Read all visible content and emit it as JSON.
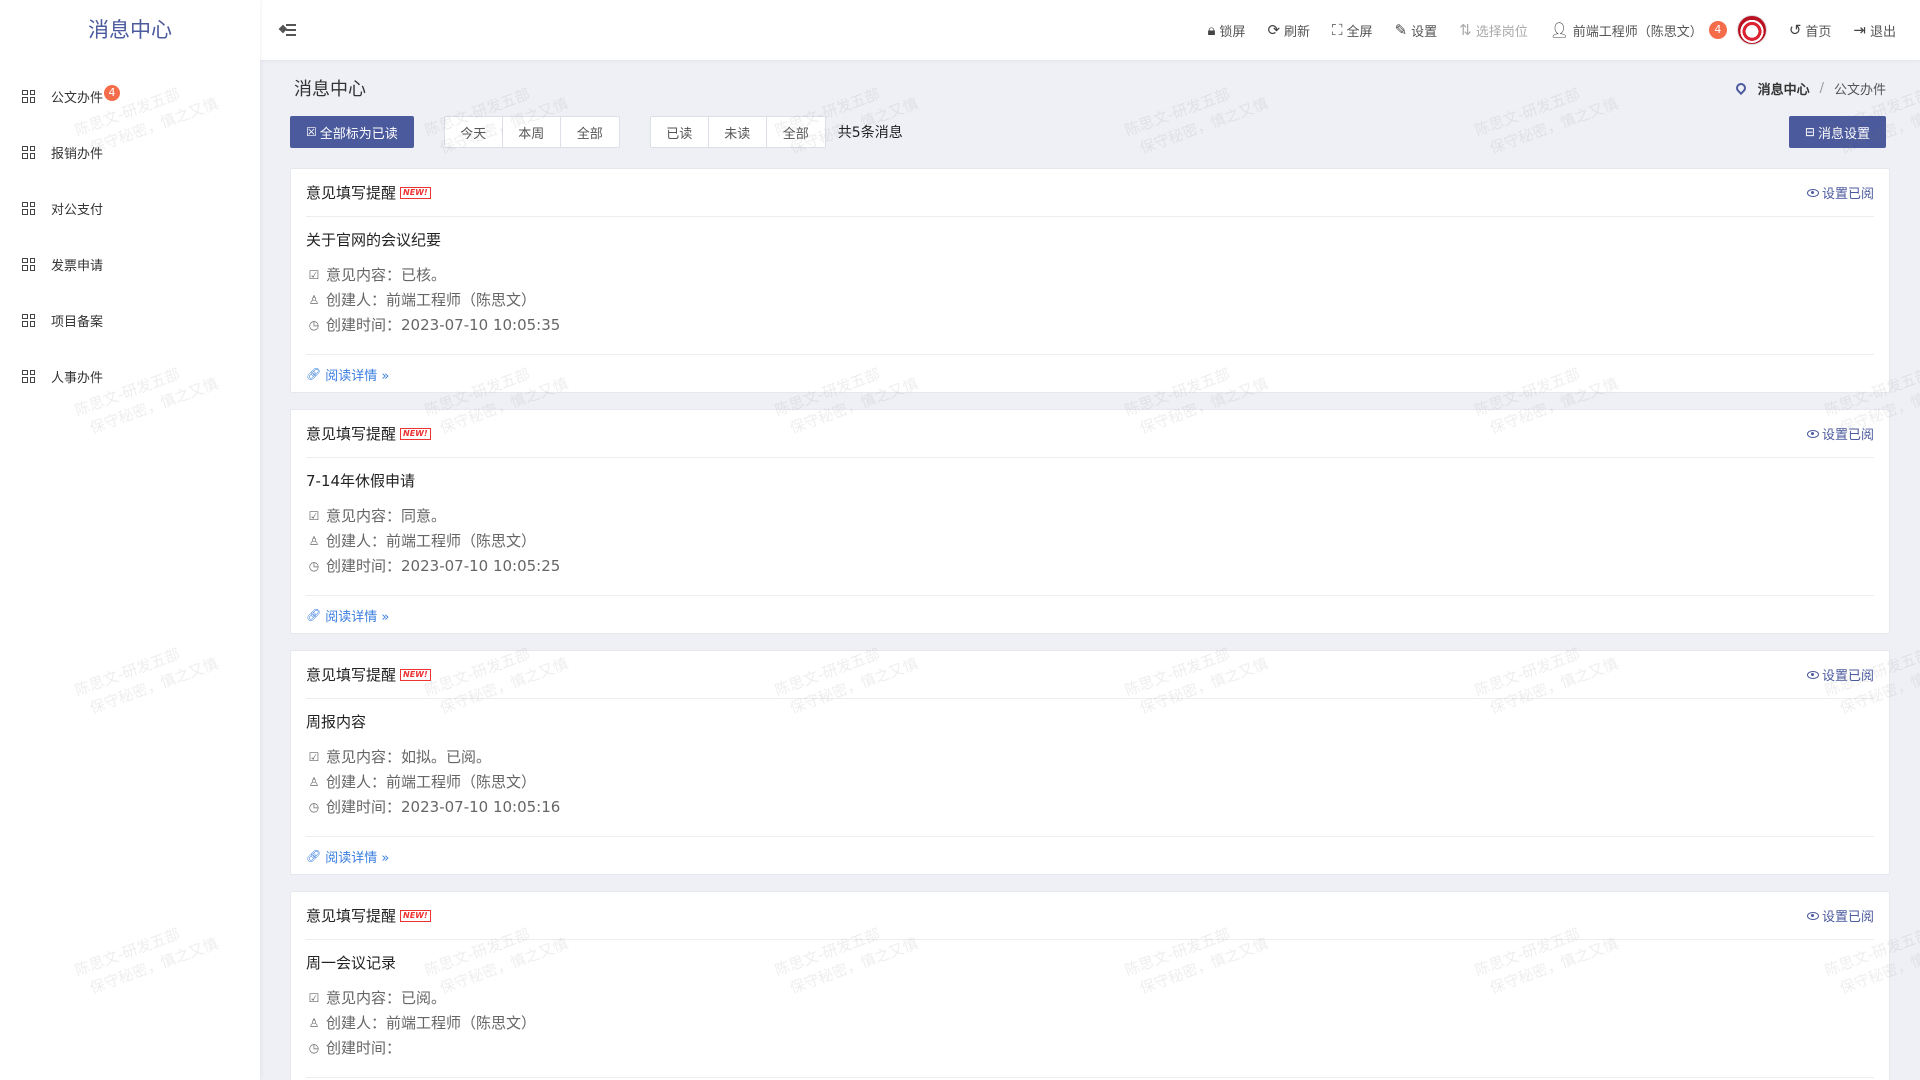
{
  "app": {
    "logo_title": "消息中心"
  },
  "sidebar": {
    "items": [
      {
        "label": "公文办件",
        "badge": "4"
      },
      {
        "label": "报销办件"
      },
      {
        "label": "对公支付"
      },
      {
        "label": "发票申请"
      },
      {
        "label": "项目备案"
      },
      {
        "label": "人事办件"
      }
    ]
  },
  "header": {
    "tools": [
      {
        "label": "锁屏",
        "icon": "lock-icon",
        "glyph": "🔒︎"
      },
      {
        "label": "刷新",
        "icon": "refresh-icon",
        "glyph": "⟳"
      },
      {
        "label": "全屏",
        "icon": "fullscreen-icon",
        "glyph": "⛶"
      },
      {
        "label": "设置",
        "icon": "edit-settings-icon",
        "glyph": "✎"
      },
      {
        "label": "选择岗位",
        "icon": "switch-position-icon",
        "glyph": "⇅",
        "disabled": true
      },
      {
        "label": "前端工程师（陈思文）",
        "icon": "user-icon",
        "glyph": "👤︎",
        "badge": "4",
        "avatar": true
      },
      {
        "label": "首页",
        "icon": "home-back-icon",
        "glyph": "↺"
      },
      {
        "label": "退出",
        "icon": "logout-icon",
        "glyph": "⇥"
      }
    ]
  },
  "main": {
    "title": "消息中心",
    "breadcrumb": {
      "current": "消息中心",
      "separator": "/",
      "child": "公文办件"
    },
    "mark_all_read": "全部标为已读",
    "time_filters": [
      "今天",
      "本周",
      "全部"
    ],
    "read_filters": [
      "已读",
      "未读",
      "全部"
    ],
    "count_text": "共5条消息",
    "settings_button": "消息设置"
  },
  "card_labels": {
    "title": "意见填写提醒",
    "new_tag": "NEW!",
    "mark_read": "设置已阅",
    "opinion_prefix": "意见内容：",
    "creator_prefix": "创建人：",
    "time_prefix": "创建时间：",
    "detail_link": "阅读详情 »"
  },
  "messages": [
    {
      "subject": "关于官网的会议纪要",
      "opinion": "已核。",
      "creator": "前端工程师（陈思文）",
      "created_at": "2023-07-10 10:05:35"
    },
    {
      "subject": "7-14年休假申请",
      "opinion": "同意。",
      "creator": "前端工程师（陈思文）",
      "created_at": "2023-07-10 10:05:25"
    },
    {
      "subject": "周报内容",
      "opinion": "如拟。已阅。",
      "creator": "前端工程师（陈思文）",
      "created_at": "2023-07-10 10:05:16"
    },
    {
      "subject": "周一会议记录",
      "opinion": "已阅。",
      "creator": "前端工程师（陈思文）",
      "created_at": ""
    }
  ],
  "watermark": {
    "line1": "陈思文-研发五部",
    "line2": "保守秘密，慎之又慎"
  },
  "colors": {
    "primary": "#4b5a9d",
    "badge": "#f56c4a",
    "link": "#3a7ee0",
    "background": "#eef0f6"
  }
}
